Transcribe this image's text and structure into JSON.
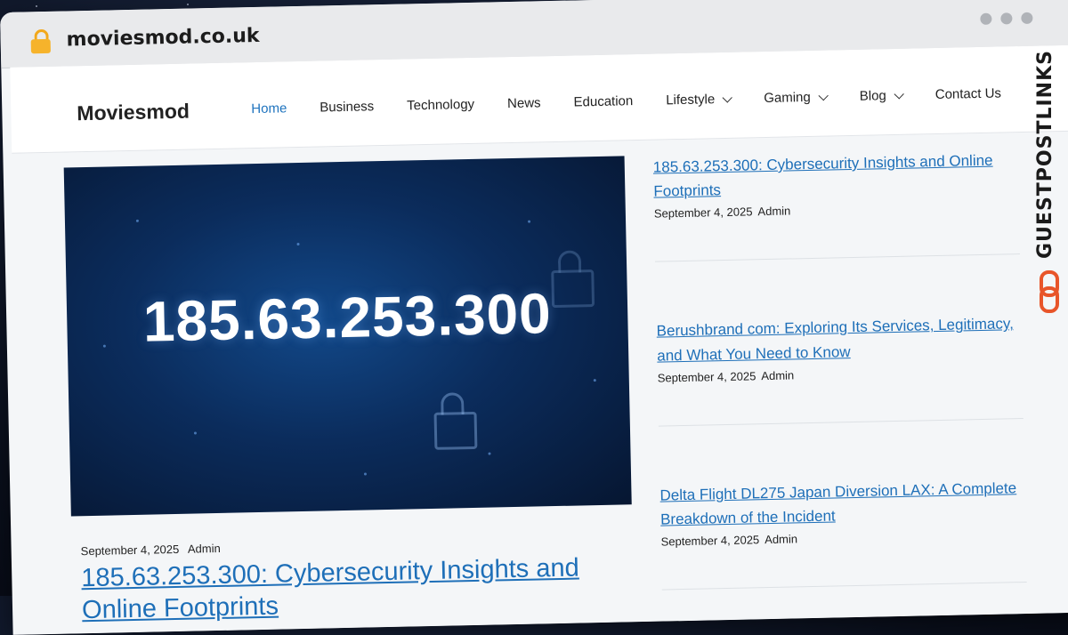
{
  "browser": {
    "url": "moviesmod.co.uk"
  },
  "site": {
    "brand": "Moviesmod",
    "nav": [
      {
        "label": "Home",
        "active": true,
        "dropdown": false
      },
      {
        "label": "Business",
        "active": false,
        "dropdown": false
      },
      {
        "label": "Technology",
        "active": false,
        "dropdown": false
      },
      {
        "label": "News",
        "active": false,
        "dropdown": false
      },
      {
        "label": "Education",
        "active": false,
        "dropdown": false
      },
      {
        "label": "Lifestyle",
        "active": false,
        "dropdown": true
      },
      {
        "label": "Gaming",
        "active": false,
        "dropdown": true
      },
      {
        "label": "Blog",
        "active": false,
        "dropdown": true
      },
      {
        "label": "Contact Us",
        "active": false,
        "dropdown": false
      }
    ]
  },
  "featured": {
    "image_text": "185.63.253.300",
    "date": "September 4, 2025",
    "author": "Admin",
    "title": "185.63.253.300: Cybersecurity Insights and Online Footprints"
  },
  "sidebar_posts": [
    {
      "title": "185.63.253.300: Cybersecurity Insights and Online Footprints",
      "date": "September 4, 2025",
      "author": "Admin"
    },
    {
      "title": "Berushbrand com: Exploring Its Services, Legitimacy, and What You Need to Know",
      "date": "September 4, 2025",
      "author": "Admin"
    },
    {
      "title": "Delta Flight DL275 Japan Diversion LAX: A Complete Breakdown of the Incident",
      "date": "September 4, 2025",
      "author": "Admin"
    }
  ],
  "watermark": {
    "text": "GUESTPOSTLINKS",
    "icon": "chain-link-icon",
    "accent": "#e8552a"
  },
  "colors": {
    "link": "#1e6fb8",
    "nav_active": "#1e73be",
    "hero_bg": "#0b2c5c"
  }
}
